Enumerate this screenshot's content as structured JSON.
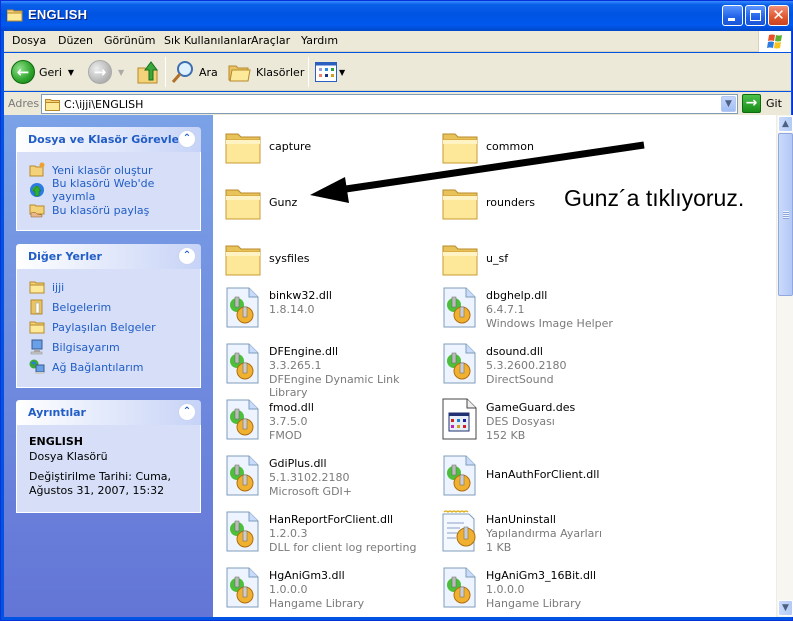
{
  "window": {
    "title": "ENGLISH",
    "controls": {
      "minimize": "minimize",
      "maximize": "maximize",
      "close": "✕"
    }
  },
  "menubar": {
    "items": [
      "Dosya",
      "Düzen",
      "Görünüm",
      "Sık Kullanılanlar",
      "Araçlar",
      "Yardım"
    ]
  },
  "toolbar": {
    "back_label": "Geri",
    "search_label": "Ara",
    "folders_label": "Klasörler"
  },
  "addressbar": {
    "label": "Adres",
    "value": "C:\\ijji\\ENGLISH",
    "go_label": "Git"
  },
  "leftpane": {
    "tasks": {
      "title": "Dosya ve Klasör Görevleri",
      "items": [
        {
          "label": "Yeni klasör oluştur",
          "icon": "new-folder-icon"
        },
        {
          "label": "Bu klasörü Web'de yayımla",
          "icon": "publish-web-icon"
        },
        {
          "label": "Bu klasörü paylaş",
          "icon": "share-folder-icon"
        }
      ]
    },
    "places": {
      "title": "Diğer Yerler",
      "items": [
        {
          "label": "ijji",
          "icon": "folder-icon"
        },
        {
          "label": "Belgelerim",
          "icon": "my-documents-icon"
        },
        {
          "label": "Paylaşılan Belgeler",
          "icon": "folder-icon"
        },
        {
          "label": "Bilgisayarım",
          "icon": "my-computer-icon"
        },
        {
          "label": "Ağ Bağlantılarım",
          "icon": "network-icon"
        }
      ]
    },
    "details": {
      "title": "Ayrıntılar",
      "name": "ENGLISH",
      "type": "Dosya Klasörü",
      "modified": "Değiştirilme Tarihi: Cuma, Ağustos 31, 2007, 15:32"
    }
  },
  "files": [
    {
      "name": "capture",
      "kind": "folder",
      "lines": []
    },
    {
      "name": "common",
      "kind": "folder",
      "lines": []
    },
    {
      "name": "Gunz",
      "kind": "folder",
      "lines": []
    },
    {
      "name": "rounders",
      "kind": "folder",
      "lines": []
    },
    {
      "name": "sysfiles",
      "kind": "folder",
      "lines": []
    },
    {
      "name": "u_sf",
      "kind": "folder",
      "lines": []
    },
    {
      "name": "binkw32.dll",
      "kind": "dll",
      "lines": [
        "1.8.14.0"
      ]
    },
    {
      "name": "dbghelp.dll",
      "kind": "dll",
      "lines": [
        "6.4.7.1",
        "Windows Image Helper"
      ]
    },
    {
      "name": "DFEngine.dll",
      "kind": "dll",
      "lines": [
        "3.3.265.1",
        "DFEngine Dynamic Link Library"
      ]
    },
    {
      "name": "dsound.dll",
      "kind": "dll",
      "lines": [
        "5.3.2600.2180",
        "DirectSound"
      ]
    },
    {
      "name": "fmod.dll",
      "kind": "dll",
      "lines": [
        "3.7.5.0",
        "FMOD"
      ]
    },
    {
      "name": "GameGuard.des",
      "kind": "des",
      "lines": [
        "DES Dosyası",
        "152 KB"
      ]
    },
    {
      "name": "GdiPlus.dll",
      "kind": "dll",
      "lines": [
        "5.1.3102.2180",
        "Microsoft GDI+"
      ]
    },
    {
      "name": "HanAuthForClient.dll",
      "kind": "dll",
      "lines": []
    },
    {
      "name": "HanReportForClient.dll",
      "kind": "dll",
      "lines": [
        "1.2.0.3",
        "DLL for client log reporting"
      ]
    },
    {
      "name": "HanUninstall",
      "kind": "ini",
      "lines": [
        "Yapılandırma Ayarları",
        "1 KB"
      ]
    },
    {
      "name": "HgAniGm3.dll",
      "kind": "dll",
      "lines": [
        "1.0.0.0",
        "Hangame Library"
      ]
    },
    {
      "name": "HgAniGm3_16Bit.dll",
      "kind": "dll",
      "lines": [
        "1.0.0.0",
        "Hangame Library"
      ]
    }
  ],
  "scrollbar": {
    "position_fraction": 0.0,
    "visible_fraction": 0.35
  },
  "annotation": {
    "text": "Gunz´a tıklıyoruz.",
    "points_to": "Gunz"
  }
}
